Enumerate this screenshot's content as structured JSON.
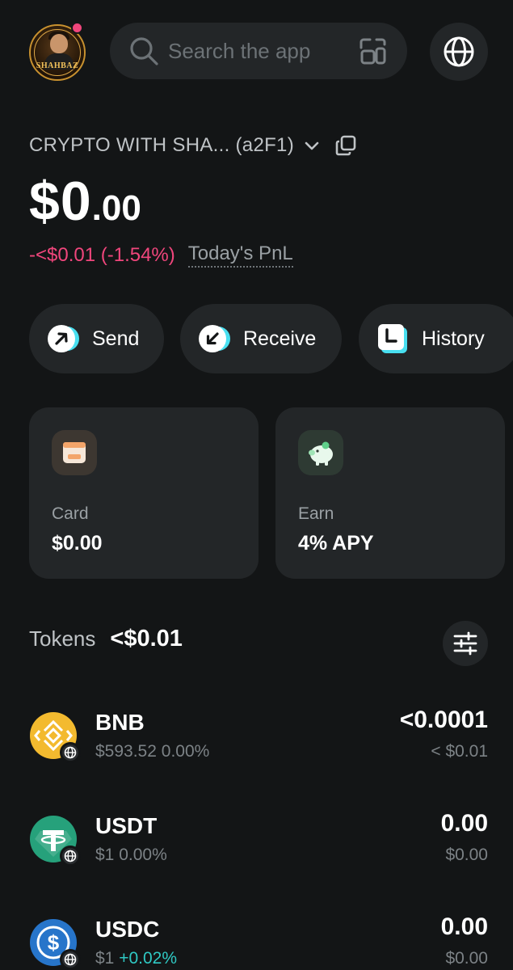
{
  "header": {
    "avatar_brand": "SHAHBAZ",
    "search_placeholder": "Search the app"
  },
  "wallet": {
    "name": "CRYPTO WITH SHA... (a2F1)",
    "balance_whole": "$0",
    "balance_cents": ".00",
    "pnl_value": "-<$0.01 (-1.54%)",
    "pnl_label": "Today's PnL"
  },
  "actions": [
    {
      "label": "Send",
      "icon": "arrow-up-right-icon"
    },
    {
      "label": "Receive",
      "icon": "arrow-down-left-icon"
    },
    {
      "label": "History",
      "icon": "clock-icon"
    }
  ],
  "tiles": [
    {
      "title": "Card",
      "value": "$0.00",
      "icon": "wallet-card-icon"
    },
    {
      "title": "Earn",
      "value": "4%  APY",
      "icon": "piggy-bank-icon"
    }
  ],
  "tokens": {
    "label": "Tokens",
    "total": "<$0.01",
    "items": [
      {
        "symbol": "BNB",
        "price": "$593.52",
        "change": "0.00%",
        "change_dir": "flat",
        "amount": "<0.0001",
        "fiat": "< $0.01",
        "color": "#F3BA2F"
      },
      {
        "symbol": "USDT",
        "price": "$1",
        "change": "0.00%",
        "change_dir": "flat",
        "amount": "0.00",
        "fiat": "$0.00",
        "color": "#26A17B"
      },
      {
        "symbol": "USDC",
        "price": "$1",
        "change": "+0.02%",
        "change_dir": "up",
        "amount": "0.00",
        "fiat": "$0.00",
        "color": "#2775CA"
      }
    ]
  },
  "colors": {
    "background": "#131516",
    "surface": "#232628",
    "negative": "#f0467c",
    "positive": "#2fc9c4",
    "accent": "#48dff0"
  }
}
